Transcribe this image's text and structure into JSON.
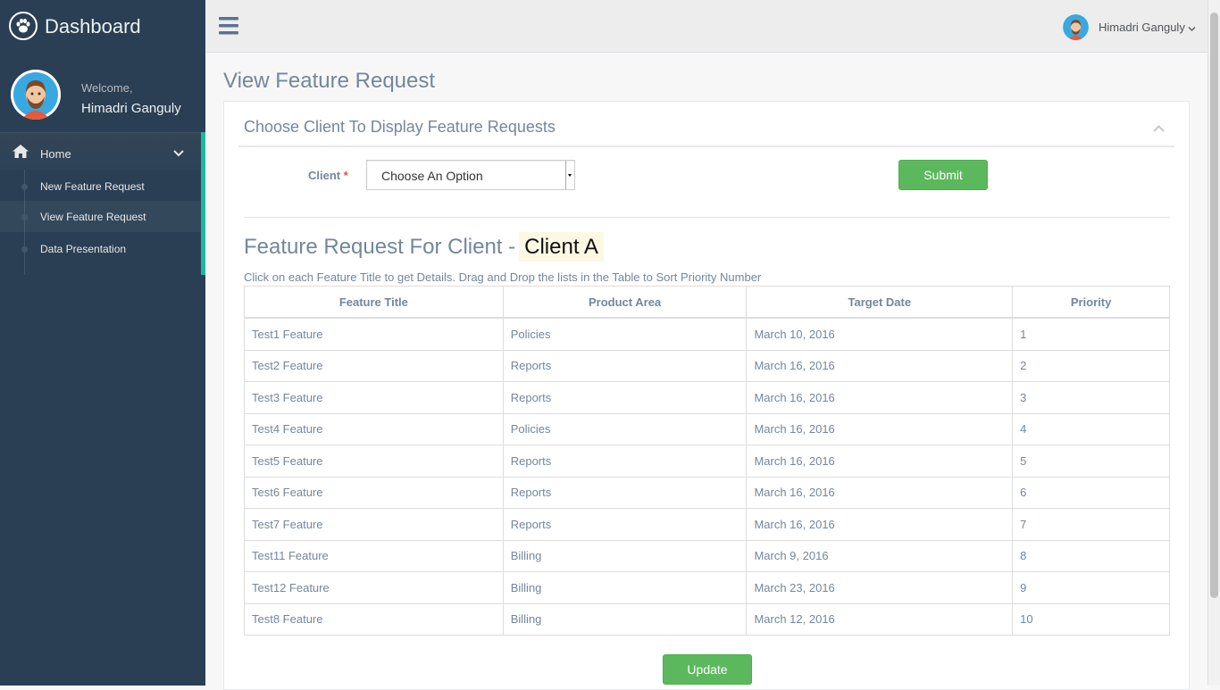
{
  "sidebar": {
    "brand": "Dashboard",
    "brand_icon": "paw-icon",
    "welcome": "Welcome,",
    "user_name": "Himadri Ganguly",
    "menu": {
      "home_label": "Home",
      "items": [
        {
          "label": "New Feature Request"
        },
        {
          "label": "View Feature Request"
        },
        {
          "label": "Data Presentation"
        }
      ]
    }
  },
  "topnav": {
    "user_name": "Himadri Ganguly"
  },
  "page": {
    "title": "View Feature Request"
  },
  "panel": {
    "title": "Choose Client To Display Feature Requests",
    "client_label": "Client",
    "required_mark": "*",
    "select_value": "Choose An Option",
    "submit_label": "Submit",
    "heading_prefix": "Feature Request For Client -",
    "client_name": "Client A",
    "hint": "Click on each Feature Title to get Details. Drag and Drop the lists in the Table to Sort Priority Number",
    "update_label": "Update"
  },
  "table": {
    "headers": [
      "Feature Title",
      "Product Area",
      "Target Date",
      "Priority"
    ],
    "rows": [
      [
        "Test1 Feature",
        "Policies",
        "March 10, 2016",
        "1"
      ],
      [
        "Test2 Feature",
        "Reports",
        "March 16, 2016",
        "2"
      ],
      [
        "Test3 Feature",
        "Reports",
        "March 16, 2016",
        "3"
      ],
      [
        "Test4 Feature",
        "Policies",
        "March 16, 2016",
        "4"
      ],
      [
        "Test5 Feature",
        "Reports",
        "March 16, 2016",
        "5"
      ],
      [
        "Test6 Feature",
        "Reports",
        "March 16, 2016",
        "6"
      ],
      [
        "Test7 Feature",
        "Reports",
        "March 16, 2016",
        "7"
      ],
      [
        "Test11 Feature",
        "Billing",
        "March 9, 2016",
        "8"
      ],
      [
        "Test12 Feature",
        "Billing",
        "March 23, 2016",
        "9"
      ],
      [
        "Test8 Feature",
        "Billing",
        "March 12, 2016",
        "10"
      ]
    ]
  },
  "colors": {
    "sidebar_bg": "#2A3F54",
    "accent": "#1ABB9C",
    "button_green": "#5CB85C",
    "highlight": "#FCF8E3"
  }
}
